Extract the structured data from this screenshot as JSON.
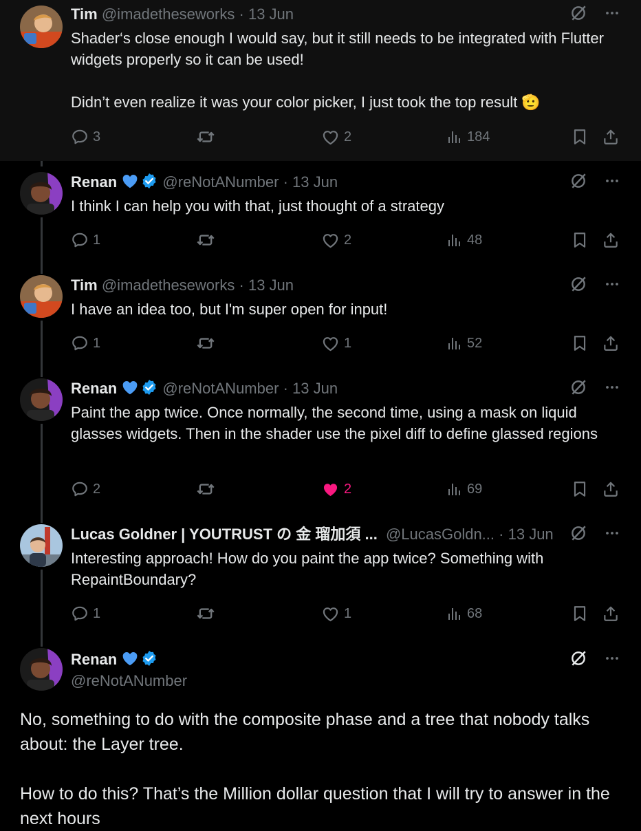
{
  "colors": {
    "background": "#000000",
    "highlight_background": "#101010",
    "text": "#e7e9ea",
    "muted": "#71767b",
    "verified_blue": "#1d9bf0",
    "heart_blue": "#4b9cf5",
    "like_pink": "#f91880",
    "thread_line": "#333639"
  },
  "tweets": [
    {
      "author": "Tim",
      "handle": "@imadetheseworks",
      "dot": "·",
      "date": "13 Jun",
      "paragraphs": [
        "Shader‘s close enough I would say, but it still needs to be integrated with Flutter widgets properly so it can be used!",
        "Didn’t even realize it was your color picker, I just took the top result 🫡"
      ],
      "replies": "3",
      "likes": "2",
      "views": "184",
      "liked": false
    },
    {
      "author": "Renan",
      "handle": "@reNotANumber",
      "dot": "·",
      "date": "13 Jun",
      "paragraphs": [
        "I think I can help you with that, just thought of a strategy"
      ],
      "replies": "1",
      "likes": "2",
      "views": "48",
      "liked": false
    },
    {
      "author": "Tim",
      "handle": "@imadetheseworks",
      "dot": "·",
      "date": "13 Jun",
      "paragraphs": [
        "I have an idea too, but I'm super open for input!"
      ],
      "replies": "1",
      "likes": "1",
      "views": "52",
      "liked": false
    },
    {
      "author": "Renan",
      "handle": "@reNotANumber",
      "dot": "·",
      "date": "13 Jun",
      "paragraphs": [
        "Paint the app twice. Once normally, the second time, using a mask on liquid glasses widgets. Then in the shader use the pixel diff to define glassed regions"
      ],
      "replies": "2",
      "likes": "2",
      "views": "69",
      "liked": true
    },
    {
      "author": "Lucas Goldner | YOUTRUST の 金 瑠加須 ...",
      "handle": "@LucasGoldn...",
      "dot": "·",
      "date": "13 Jun",
      "paragraphs": [
        "Interesting approach! How do you paint the app twice? Something with RepaintBoundary?"
      ],
      "replies": "1",
      "likes": "1",
      "views": "68",
      "liked": false
    }
  ],
  "main_tweet": {
    "author": "Renan",
    "handle": "@reNotANumber",
    "paragraphs": [
      "No, something to do with the composite phase and a tree that nobody talks about: the Layer tree.",
      "How to do this? That’s the Million dollar question that I will try to answer in the next hours"
    ]
  },
  "icons": {
    "reply": "reply-icon",
    "retweet": "retweet-icon",
    "like": "heart-icon",
    "views": "views-icon",
    "bookmark": "bookmark-icon",
    "share": "share-icon",
    "grok": "grok-icon",
    "more": "more-icon"
  }
}
